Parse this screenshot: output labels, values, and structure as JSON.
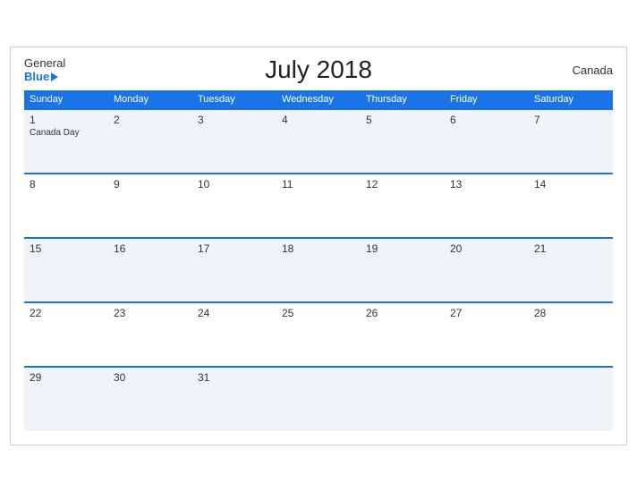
{
  "header": {
    "logo_general": "General",
    "logo_blue": "Blue",
    "title": "July 2018",
    "country": "Canada"
  },
  "weekdays": [
    "Sunday",
    "Monday",
    "Tuesday",
    "Wednesday",
    "Thursday",
    "Friday",
    "Saturday"
  ],
  "weeks": [
    [
      {
        "day": "1",
        "holiday": "Canada Day"
      },
      {
        "day": "2",
        "holiday": ""
      },
      {
        "day": "3",
        "holiday": ""
      },
      {
        "day": "4",
        "holiday": ""
      },
      {
        "day": "5",
        "holiday": ""
      },
      {
        "day": "6",
        "holiday": ""
      },
      {
        "day": "7",
        "holiday": ""
      }
    ],
    [
      {
        "day": "8",
        "holiday": ""
      },
      {
        "day": "9",
        "holiday": ""
      },
      {
        "day": "10",
        "holiday": ""
      },
      {
        "day": "11",
        "holiday": ""
      },
      {
        "day": "12",
        "holiday": ""
      },
      {
        "day": "13",
        "holiday": ""
      },
      {
        "day": "14",
        "holiday": ""
      }
    ],
    [
      {
        "day": "15",
        "holiday": ""
      },
      {
        "day": "16",
        "holiday": ""
      },
      {
        "day": "17",
        "holiday": ""
      },
      {
        "day": "18",
        "holiday": ""
      },
      {
        "day": "19",
        "holiday": ""
      },
      {
        "day": "20",
        "holiday": ""
      },
      {
        "day": "21",
        "holiday": ""
      }
    ],
    [
      {
        "day": "22",
        "holiday": ""
      },
      {
        "day": "23",
        "holiday": ""
      },
      {
        "day": "24",
        "holiday": ""
      },
      {
        "day": "25",
        "holiday": ""
      },
      {
        "day": "26",
        "holiday": ""
      },
      {
        "day": "27",
        "holiday": ""
      },
      {
        "day": "28",
        "holiday": ""
      }
    ],
    [
      {
        "day": "29",
        "holiday": ""
      },
      {
        "day": "30",
        "holiday": ""
      },
      {
        "day": "31",
        "holiday": ""
      },
      {
        "day": "",
        "holiday": ""
      },
      {
        "day": "",
        "holiday": ""
      },
      {
        "day": "",
        "holiday": ""
      },
      {
        "day": "",
        "holiday": ""
      }
    ]
  ]
}
